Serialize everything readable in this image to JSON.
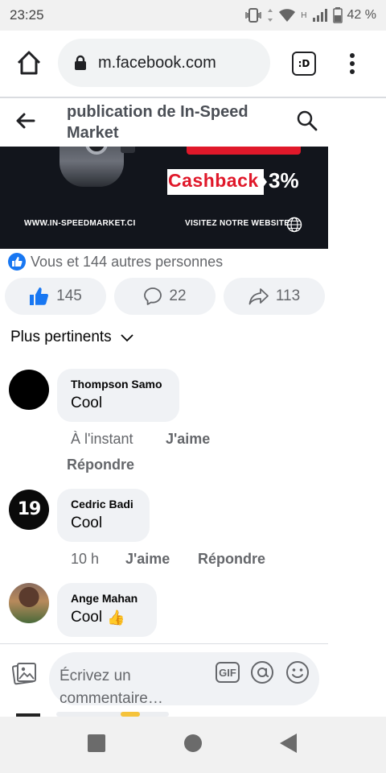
{
  "status_bar": {
    "time": "23:25",
    "network_label": "H",
    "battery": "42 %"
  },
  "browser": {
    "url": "m.facebook.com",
    "tabs_label": ":D",
    "icons": [
      "home-icon",
      "lock-icon",
      "tabs-icon",
      "menu-icon"
    ]
  },
  "header": {
    "title": "publication de In-Speed Market",
    "icons": [
      "back-arrow-icon",
      "search-icon"
    ]
  },
  "ad": {
    "headline": "Cashback",
    "percent": "3%",
    "website": "WWW.IN-SPEEDMARKET.CI",
    "visit": "VISITEZ NOTRE WEBSITE",
    "colors": {
      "background": "#12151c",
      "accent": "#e0182a"
    }
  },
  "reactions": {
    "summary": "Vous et 144 autres personnes",
    "like_count": "145",
    "comment_count": "22",
    "share_count": "113",
    "accent": "#1877f2"
  },
  "sort": {
    "label": "Plus pertinents"
  },
  "comments": [
    {
      "author": "Thompson Samo",
      "text": "Cool",
      "emoji": "",
      "time": "À l'instant",
      "like_label": "J'aime",
      "reply_label": "Répondre"
    },
    {
      "author": "Cedric Badi",
      "text": "Cool",
      "emoji": "",
      "time": "10 h",
      "like_label": "J'aime",
      "reply_label": "Répondre",
      "avatar_text": "19"
    },
    {
      "author": "Ange Mahan",
      "text": "Cool",
      "emoji": "👍"
    }
  ],
  "composer": {
    "placeholder": "Écrivez un commentaire…",
    "gif_label": "GIF",
    "icons": [
      "photo-icon",
      "gif-icon",
      "at-icon",
      "emoji-icon"
    ]
  },
  "nav": {
    "icons": [
      "recents-icon",
      "home-circle-icon",
      "back-triangle-icon"
    ]
  }
}
